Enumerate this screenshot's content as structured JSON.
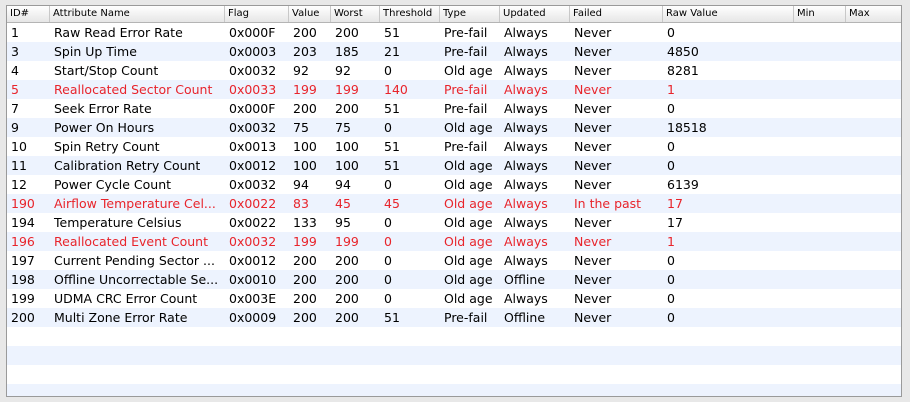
{
  "columns": [
    "ID#",
    "Attribute Name",
    "Flag",
    "Value",
    "Worst",
    "Threshold",
    "Type",
    "Updated",
    "Failed",
    "Raw Value",
    "Min",
    "Max"
  ],
  "rows": [
    {
      "id": "1",
      "name": "Raw Read Error Rate",
      "flag": "0x000F",
      "value": "200",
      "worst": "200",
      "threshold": "51",
      "type": "Pre-fail",
      "updated": "Always",
      "failed": "Never",
      "raw": "0",
      "min": "",
      "max": "",
      "warn": false
    },
    {
      "id": "3",
      "name": "Spin Up Time",
      "flag": "0x0003",
      "value": "203",
      "worst": "185",
      "threshold": "21",
      "type": "Pre-fail",
      "updated": "Always",
      "failed": "Never",
      "raw": "4850",
      "min": "",
      "max": "",
      "warn": false
    },
    {
      "id": "4",
      "name": "Start/Stop Count",
      "flag": "0x0032",
      "value": "92",
      "worst": "92",
      "threshold": "0",
      "type": "Old age",
      "updated": "Always",
      "failed": "Never",
      "raw": "8281",
      "min": "",
      "max": "",
      "warn": false
    },
    {
      "id": "5",
      "name": "Reallocated Sector Count",
      "flag": "0x0033",
      "value": "199",
      "worst": "199",
      "threshold": "140",
      "type": "Pre-fail",
      "updated": "Always",
      "failed": "Never",
      "raw": "1",
      "min": "",
      "max": "",
      "warn": true
    },
    {
      "id": "7",
      "name": "Seek Error Rate",
      "flag": "0x000F",
      "value": "200",
      "worst": "200",
      "threshold": "51",
      "type": "Pre-fail",
      "updated": "Always",
      "failed": "Never",
      "raw": "0",
      "min": "",
      "max": "",
      "warn": false
    },
    {
      "id": "9",
      "name": "Power On Hours",
      "flag": "0x0032",
      "value": "75",
      "worst": "75",
      "threshold": "0",
      "type": "Old age",
      "updated": "Always",
      "failed": "Never",
      "raw": "18518",
      "min": "",
      "max": "",
      "warn": false
    },
    {
      "id": "10",
      "name": "Spin Retry Count",
      "flag": "0x0013",
      "value": "100",
      "worst": "100",
      "threshold": "51",
      "type": "Pre-fail",
      "updated": "Always",
      "failed": "Never",
      "raw": "0",
      "min": "",
      "max": "",
      "warn": false
    },
    {
      "id": "11",
      "name": "Calibration Retry Count",
      "flag": "0x0012",
      "value": "100",
      "worst": "100",
      "threshold": "51",
      "type": "Old age",
      "updated": "Always",
      "failed": "Never",
      "raw": "0",
      "min": "",
      "max": "",
      "warn": false
    },
    {
      "id": "12",
      "name": "Power Cycle Count",
      "flag": "0x0032",
      "value": "94",
      "worst": "94",
      "threshold": "0",
      "type": "Old age",
      "updated": "Always",
      "failed": "Never",
      "raw": "6139",
      "min": "",
      "max": "",
      "warn": false
    },
    {
      "id": "190",
      "name": "Airflow Temperature Cel...",
      "flag": "0x0022",
      "value": "83",
      "worst": "45",
      "threshold": "45",
      "type": "Old age",
      "updated": "Always",
      "failed": "In the past",
      "raw": "17",
      "min": "",
      "max": "",
      "warn": true
    },
    {
      "id": "194",
      "name": "Temperature Celsius",
      "flag": "0x0022",
      "value": "133",
      "worst": "95",
      "threshold": "0",
      "type": "Old age",
      "updated": "Always",
      "failed": "Never",
      "raw": "17",
      "min": "",
      "max": "",
      "warn": false
    },
    {
      "id": "196",
      "name": "Reallocated Event Count",
      "flag": "0x0032",
      "value": "199",
      "worst": "199",
      "threshold": "0",
      "type": "Old age",
      "updated": "Always",
      "failed": "Never",
      "raw": "1",
      "min": "",
      "max": "",
      "warn": true
    },
    {
      "id": "197",
      "name": "Current Pending Sector ...",
      "flag": "0x0012",
      "value": "200",
      "worst": "200",
      "threshold": "0",
      "type": "Old age",
      "updated": "Always",
      "failed": "Never",
      "raw": "0",
      "min": "",
      "max": "",
      "warn": false
    },
    {
      "id": "198",
      "name": "Offline Uncorrectable Se...",
      "flag": "0x0010",
      "value": "200",
      "worst": "200",
      "threshold": "0",
      "type": "Old age",
      "updated": "Offline",
      "failed": "Never",
      "raw": "0",
      "min": "",
      "max": "",
      "warn": false
    },
    {
      "id": "199",
      "name": "UDMA CRC Error Count",
      "flag": "0x003E",
      "value": "200",
      "worst": "200",
      "threshold": "0",
      "type": "Old age",
      "updated": "Always",
      "failed": "Never",
      "raw": "0",
      "min": "",
      "max": "",
      "warn": false
    },
    {
      "id": "200",
      "name": "Multi Zone Error Rate",
      "flag": "0x0009",
      "value": "200",
      "worst": "200",
      "threshold": "51",
      "type": "Pre-fail",
      "updated": "Offline",
      "failed": "Never",
      "raw": "0",
      "min": "",
      "max": "",
      "warn": false
    }
  ],
  "colors": {
    "warning_text": "#e8242b",
    "alt_row": "#edf3fe",
    "header_border": "#b4b4b4"
  }
}
